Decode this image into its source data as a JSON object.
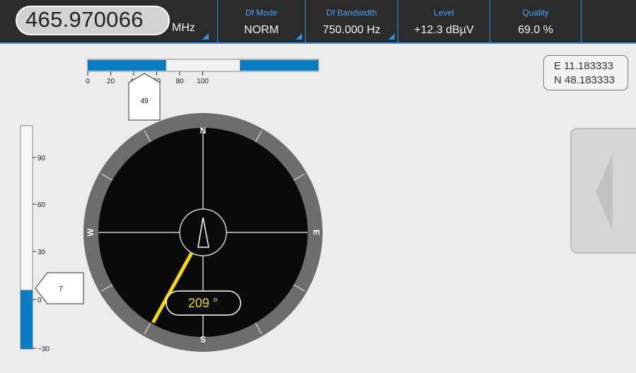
{
  "header": {
    "frequency": {
      "value": "465.970066",
      "unit": "MHz"
    },
    "fields": [
      {
        "label": "Df Mode",
        "value": "NORM"
      },
      {
        "label": "Df Bandwidth",
        "value": "750.000 Hz"
      },
      {
        "label": "Level",
        "value": "+12.3 dBµV"
      },
      {
        "label": "Quality",
        "value": "69.0 %"
      }
    ],
    "accent_color": "#3a8fd8"
  },
  "quality_bar": {
    "ticks": [
      "0",
      "20",
      "40",
      "60",
      "80",
      "100"
    ],
    "marker": "49",
    "blue_ranges": [
      [
        0,
        34
      ],
      [
        66,
        100
      ]
    ],
    "bar_color": "#0a7cc2"
  },
  "level_bar": {
    "ticks": [
      "90",
      "60",
      "30",
      "0",
      "−30"
    ],
    "marker": "7",
    "fill_value": 7,
    "range": [
      -30,
      110
    ],
    "fill_color": "#0a7cc2"
  },
  "compass": {
    "directions": {
      "n": "N",
      "e": "E",
      "s": "S",
      "w": "W"
    },
    "bearing_value": 209,
    "bearing_text": "209 °",
    "needle_color": "#f5d90a"
  },
  "coordinates": {
    "east": "E 11.183333",
    "north": "N 48.183333"
  }
}
